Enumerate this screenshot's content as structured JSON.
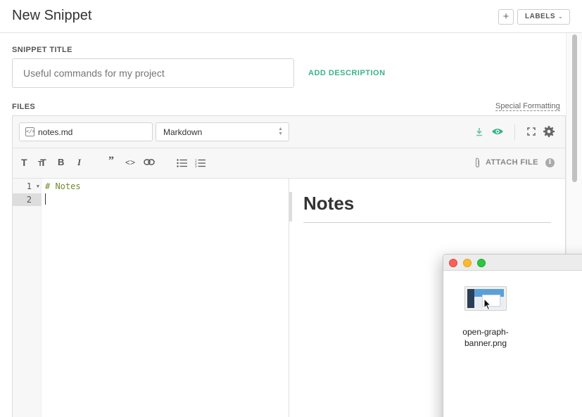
{
  "header": {
    "title": "New Snippet",
    "plus_label": "+",
    "labels_label": "LABELS"
  },
  "snippet_title": {
    "label": "SNIPPET TITLE",
    "placeholder": "Useful commands for my project",
    "add_description": "ADD DESCRIPTION"
  },
  "files": {
    "label": "FILES",
    "special_formatting": "Special Formatting",
    "filename": "notes.md",
    "language": "Markdown",
    "attach_file": "ATTACH FILE"
  },
  "toolbar_icons": [
    "heading-icon",
    "text-size-icon",
    "bold-icon",
    "italic-icon",
    "quote-icon",
    "code-icon",
    "link-icon",
    "bullet-list-icon",
    "numbered-list-icon"
  ],
  "code": {
    "line_numbers": [
      "1",
      "2"
    ],
    "lines": [
      "# Notes",
      ""
    ]
  },
  "preview": {
    "heading": "Notes"
  },
  "finder": {
    "file_name_line1": "open-graph-",
    "file_name_line2": "banner.png"
  },
  "colors": {
    "accent": "#38b28c",
    "code_green": "#6f8a2b"
  }
}
